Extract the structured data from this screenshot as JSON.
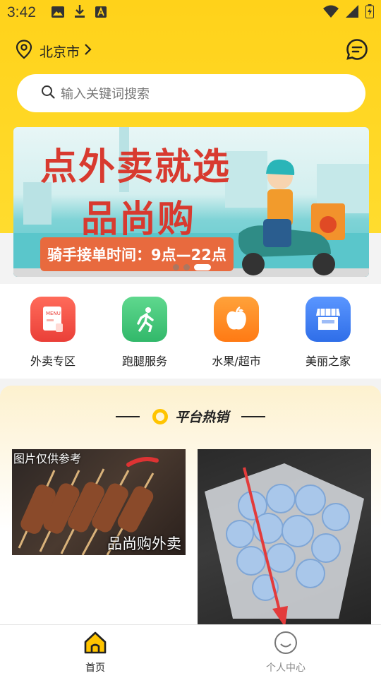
{
  "status_bar": {
    "time": "3:42"
  },
  "header": {
    "city": "北京市"
  },
  "search": {
    "placeholder": "输入关键词搜索"
  },
  "banner": {
    "title_line1": "点外卖就选",
    "title_line2": "品尚购",
    "tag": "骑手接单时间：9点—22点",
    "slide_count": 3,
    "active_slide": 3
  },
  "categories": [
    {
      "label": "外卖专区",
      "icon": "menu-icon",
      "color": "#f2554a"
    },
    {
      "label": "跑腿服务",
      "icon": "runner-icon",
      "color": "#3ec47a"
    },
    {
      "label": "水果/超市",
      "icon": "apple-icon",
      "color": "#ff8a1e"
    },
    {
      "label": "美丽之家",
      "icon": "store-icon",
      "color": "#3b7df0"
    }
  ],
  "hot_section": {
    "title": "平台热销",
    "products": [
      {
        "overlay_top": "图片仅供参考",
        "overlay_bottom": "品尚购外卖"
      },
      {
        "overlay_top": "",
        "overlay_bottom": ""
      }
    ]
  },
  "bottom_nav": [
    {
      "label": "首页",
      "active": true
    },
    {
      "label": "个人中心",
      "active": false
    }
  ],
  "colors": {
    "brand_yellow": "#ffd21a",
    "accent_red": "#d83a2f",
    "arrow_red": "#e33b3b"
  }
}
